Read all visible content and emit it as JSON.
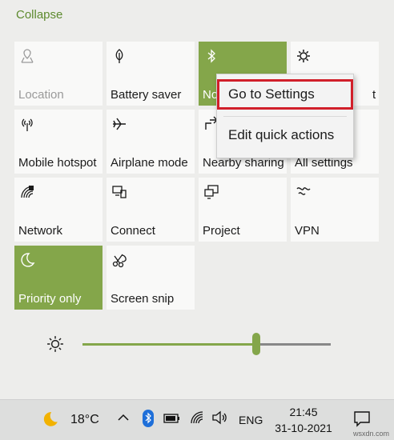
{
  "panel": {
    "collapse_label": "Collapse"
  },
  "tiles": [
    {
      "label": "Location",
      "icon": "location-icon",
      "state": "disabled"
    },
    {
      "label": "Battery saver",
      "icon": "leaf-icon",
      "state": "off"
    },
    {
      "label": "No",
      "icon": "bluetooth-icon",
      "state": "on"
    },
    {
      "label": "t",
      "icon": "brightness-icon",
      "state": "off"
    },
    {
      "label": "Mobile hotspot",
      "icon": "hotspot-icon",
      "state": "off"
    },
    {
      "label": "Airplane mode",
      "icon": "airplane-icon",
      "state": "off"
    },
    {
      "label": "Nearby sharing",
      "icon": "share-icon",
      "state": "off"
    },
    {
      "label": "All settings",
      "icon": "gear-icon",
      "state": "off"
    },
    {
      "label": "Network",
      "icon": "network-icon",
      "state": "off"
    },
    {
      "label": "Connect",
      "icon": "connect-icon",
      "state": "off"
    },
    {
      "label": "Project",
      "icon": "project-icon",
      "state": "off"
    },
    {
      "label": "VPN",
      "icon": "vpn-icon",
      "state": "off"
    },
    {
      "label": "Priority only",
      "icon": "moon-icon",
      "state": "on"
    },
    {
      "label": "Screen snip",
      "icon": "snip-icon",
      "state": "off"
    }
  ],
  "context_menu": {
    "items": [
      {
        "label": "Go to Settings",
        "highlighted": true
      },
      {
        "label": "Edit quick actions",
        "highlighted": false
      }
    ]
  },
  "brightness": {
    "level_percent": 70
  },
  "taskbar": {
    "temperature": "18°C",
    "language": "ENG",
    "time": "21:45",
    "date": "31-10-2021"
  },
  "watermark": "wsxdn.com",
  "colors": {
    "accent": "#84a64a",
    "highlight_border": "#d11f2a",
    "collapse_text": "#5d8a2e"
  }
}
